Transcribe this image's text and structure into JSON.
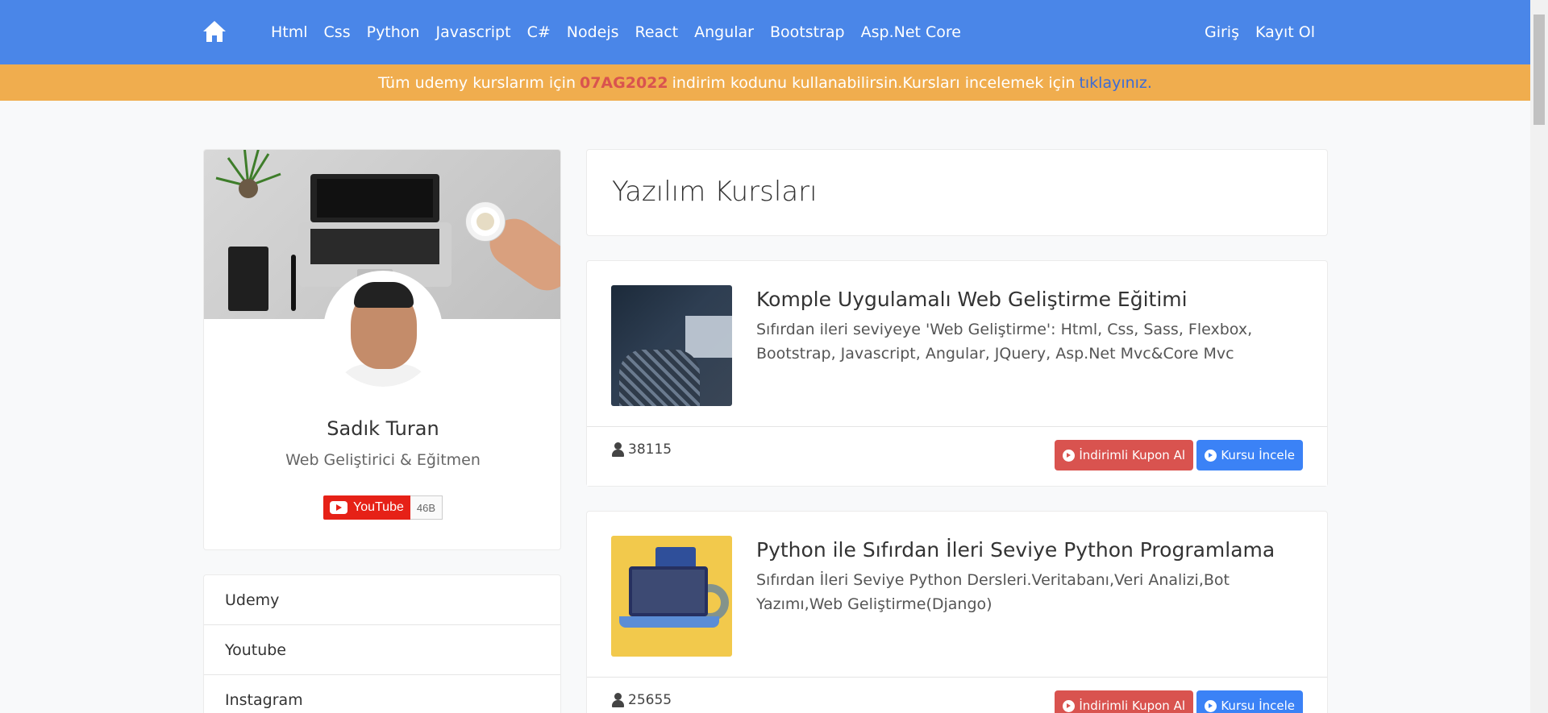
{
  "nav": {
    "links": [
      "Html",
      "Css",
      "Python",
      "Javascript",
      "C#",
      "Nodejs",
      "React",
      "Angular",
      "Bootstrap",
      "Asp.Net Core"
    ],
    "login": "Giriş",
    "register": "Kayıt Ol"
  },
  "banner": {
    "prefix": "Tüm udemy kurslarım için",
    "code": "07AG2022",
    "middle": "indirim kodunu kullanabilirsin.Kursları incelemek için",
    "link": "tıklayınız."
  },
  "profile": {
    "name": "Sadık Turan",
    "title": "Web Geliştirici & Eğitmen",
    "youtube_label": "YouTube",
    "youtube_count": "46B"
  },
  "menu": {
    "items": [
      "Udemy",
      "Youtube",
      "Instagram"
    ]
  },
  "main": {
    "title": "Yazılım Kursları"
  },
  "courses": [
    {
      "title": "Komple Uygulamalı Web Geliştirme Eğitimi",
      "description": "Sıfırdan ileri seviyeye 'Web Geliştirme': Html, Css, Sass, Flexbox, Bootstrap, Javascript, Angular, JQuery, Asp.Net Mvc&Core Mvc",
      "students": "38115",
      "coupon_label": "İndirimli Kupon Al",
      "view_label": "Kursu İncele"
    },
    {
      "title": "Python ile Sıfırdan İleri Seviye Python Programlama",
      "description": "Sıfırdan İleri Seviye Python Dersleri.Veritabanı,Veri Analizi,Bot Yazımı,Web Geliştirme(Django)",
      "students": "25655",
      "coupon_label": "İndirimli Kupon Al",
      "view_label": "Kursu İncele"
    }
  ],
  "colors": {
    "navbar": "#4a86e8",
    "banner": "#f0ad4e",
    "coupon_button": "#d9534f",
    "view_button": "#3b82f6",
    "youtube": "#e62117"
  },
  "icons": {
    "home": "home-icon",
    "students": "user-icon",
    "button": "chevron-circle-right-icon",
    "youtube": "youtube-play-icon"
  }
}
